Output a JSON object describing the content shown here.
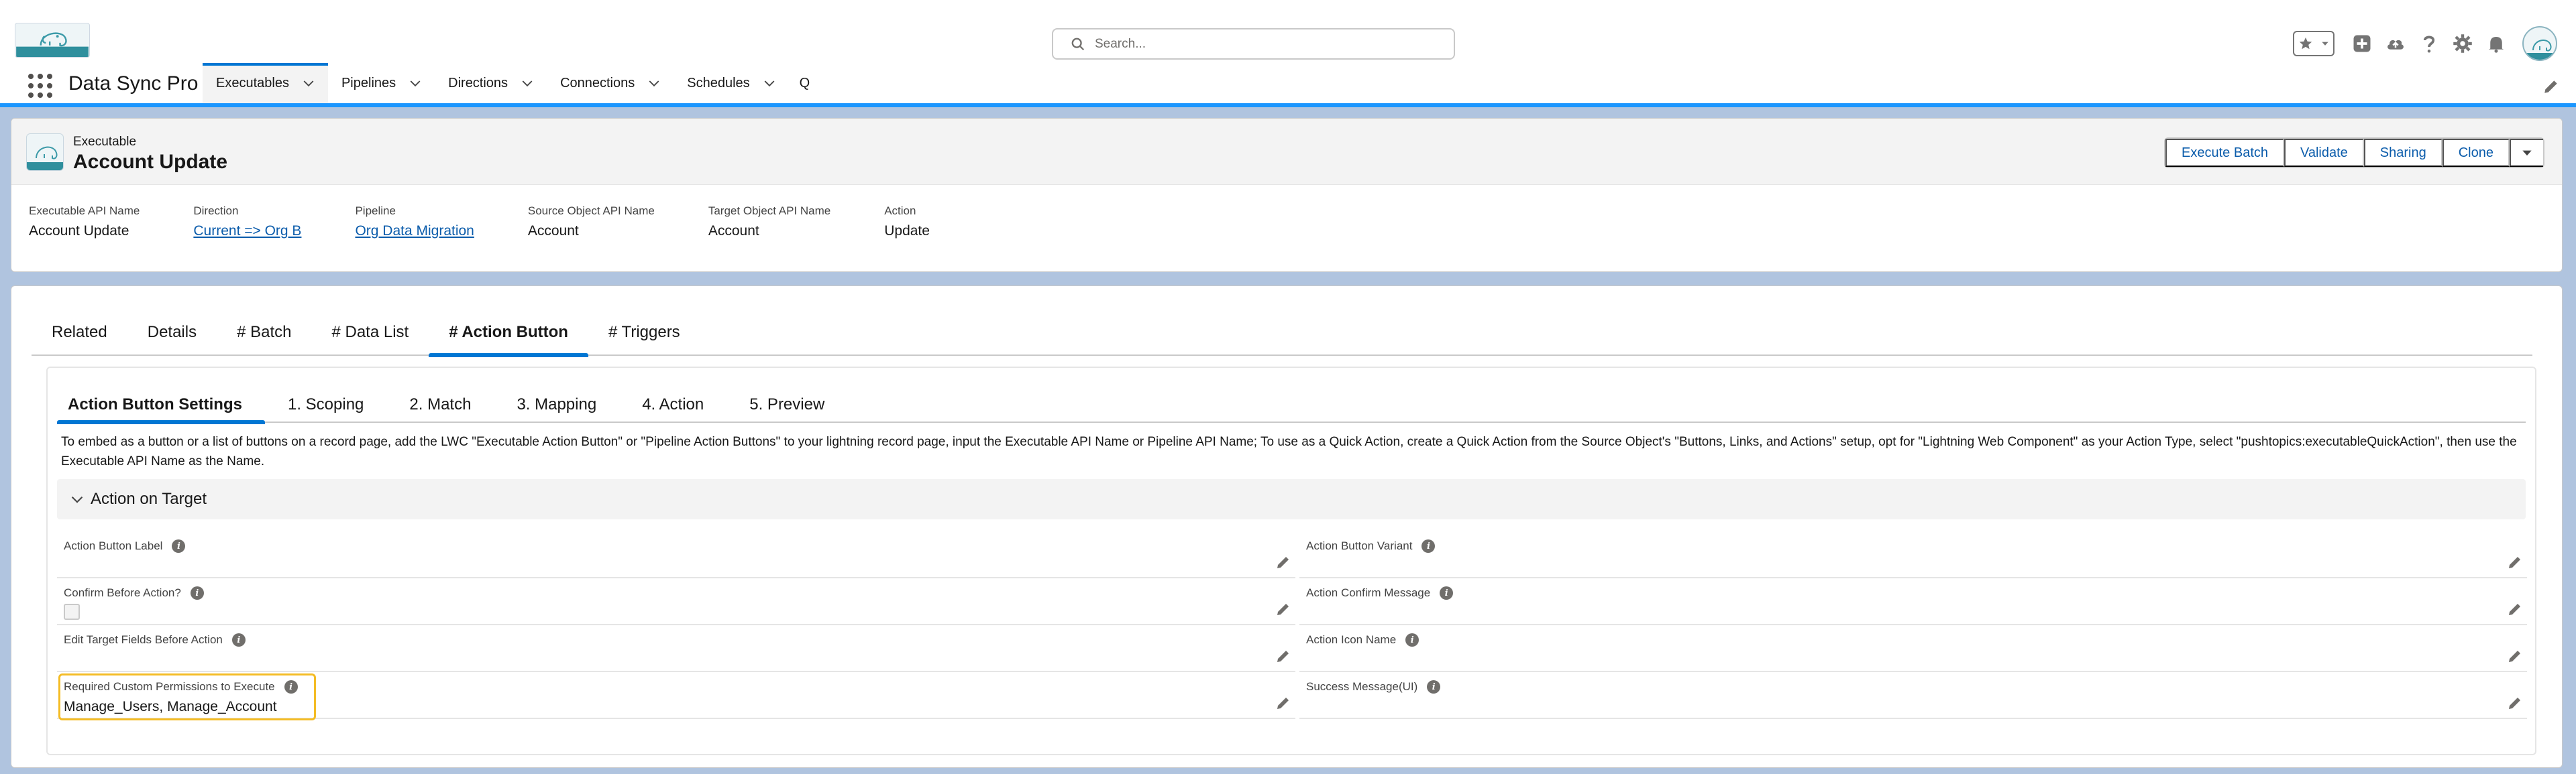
{
  "header": {
    "search_placeholder": "Search...",
    "icons": [
      "favorites-star-icon",
      "dropdown-icon",
      "add-icon",
      "cloud-icon",
      "help-icon",
      "settings-gear-icon",
      "notification-bell-icon",
      "avatar"
    ]
  },
  "nav": {
    "app_name": "Data Sync Pro",
    "items": [
      {
        "label": "Executables",
        "active": true
      },
      {
        "label": "Pipelines"
      },
      {
        "label": "Directions"
      },
      {
        "label": "Connections"
      },
      {
        "label": "Schedules"
      },
      {
        "label": "Q"
      }
    ]
  },
  "record": {
    "type": "Executable",
    "title": "Account Update",
    "actions": [
      "Execute Batch",
      "Validate",
      "Sharing",
      "Clone"
    ],
    "highlights": [
      {
        "label": "Executable API Name",
        "value": "Account Update",
        "link": false
      },
      {
        "label": "Direction",
        "value": "Current => Org B",
        "link": true
      },
      {
        "label": "Pipeline",
        "value": "Org Data Migration",
        "link": true
      },
      {
        "label": "Source Object API Name",
        "value": "Account",
        "link": false
      },
      {
        "label": "Target Object API Name",
        "value": "Account",
        "link": false
      },
      {
        "label": "Action",
        "value": "Update",
        "link": false
      }
    ]
  },
  "tabs": [
    "Related",
    "Details",
    "# Batch",
    "# Data List",
    "# Action Button",
    "# Triggers"
  ],
  "active_tab": "# Action Button",
  "inner_tabs": [
    "Action Button Settings",
    "1. Scoping",
    "2. Match",
    "3. Mapping",
    "4. Action",
    "5. Preview"
  ],
  "active_inner_tab": "Action Button Settings",
  "instructions": "To embed as a button or a list of buttons on a record page, add the LWC \"Executable Action Button\" or \"Pipeline Action Buttons\" to your lightning record page, input the Executable API Name or Pipeline API Name; To use as a Quick Action, create a Quick Action from the Source Object's \"Buttons, Links, and Actions\" setup, opt for \"Lightning Web Component\" as your Action Type, select \"pushtopics:executableQuickAction\", then use the Executable API Name as the Name.",
  "section": {
    "title": "Action on Target",
    "left_fields": [
      {
        "label": "Action Button Label",
        "value": ""
      },
      {
        "label": "Confirm Before Action?",
        "value": "",
        "checkbox": true
      },
      {
        "label": "Edit Target Fields Before Action",
        "value": ""
      },
      {
        "label": "Required Custom Permissions to Execute",
        "value": "Manage_Users, Manage_Account",
        "highlighted": true
      }
    ],
    "right_fields": [
      {
        "label": "Action Button Variant",
        "value": ""
      },
      {
        "label": "Action Confirm Message",
        "value": ""
      },
      {
        "label": "Action Icon Name",
        "value": ""
      },
      {
        "label": "Success Message(UI)",
        "value": ""
      }
    ]
  },
  "colors": {
    "brand_blue": "#0176d3",
    "link_blue": "#0b5cab",
    "nav_border": "#1b96ff",
    "background": "#b0c4df",
    "highlight_yellow": "#f4bc25"
  }
}
